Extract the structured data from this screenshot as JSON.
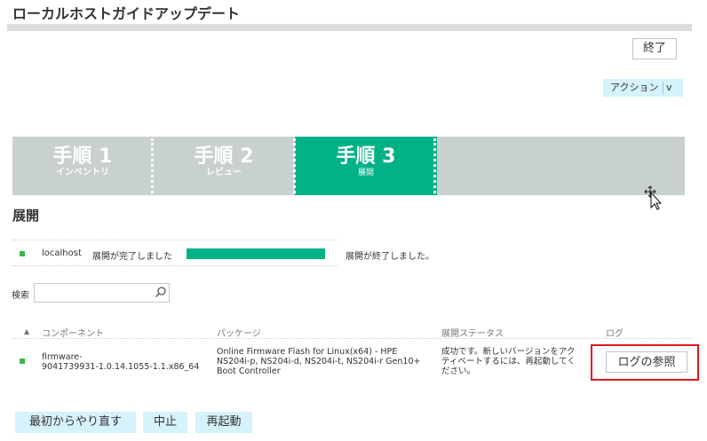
{
  "header": {
    "title": "ローカルホストガイドアップデート"
  },
  "toolbar": {
    "finish_label": "終了",
    "action_label": "アクション",
    "action_chevron": "v"
  },
  "steps": [
    {
      "title": "手順 1",
      "subtitle": "インベントリ",
      "active": false
    },
    {
      "title": "手順 2",
      "subtitle": "レビュー",
      "active": false
    },
    {
      "title": "手順 3",
      "subtitle": "展開",
      "active": true
    }
  ],
  "section": {
    "title": "展開"
  },
  "deploy_status": {
    "host": "localhost",
    "state_text": "展開が完了しました",
    "progress_percent": 100,
    "result_text": "展開が終了しました。"
  },
  "search": {
    "label": "検索",
    "value": "",
    "placeholder": ""
  },
  "table": {
    "sort_indicator": "▲",
    "columns": [
      "コンポーネント",
      "パッケージ",
      "展開ステータス",
      "ログ"
    ],
    "rows": [
      {
        "component_line1": "firmware-",
        "component_line2": "9041739931-1.0.14.1055-1.1.x86_64",
        "package_line1": "Online Firmware Flash for Linux(x64) - HPE",
        "package_line2": "NS204i-p, NS204i-d, NS204i-t, NS204i-r Gen10+",
        "package_line3": "Boot Controller",
        "status_line1": "成功です。新しいバージョンをアク",
        "status_line2": "ティベートするには、再起動してく",
        "status_line3": "ださい。",
        "log_button": "ログの参照"
      }
    ]
  },
  "footer": {
    "restart_over": "最初からやり直す",
    "abort": "中止",
    "reboot": "再起動"
  },
  "colors": {
    "accent": "#01b287",
    "status_ok": "#3cb54a",
    "highlight": "#e0161c",
    "button_bg": "#d6f2fb"
  }
}
